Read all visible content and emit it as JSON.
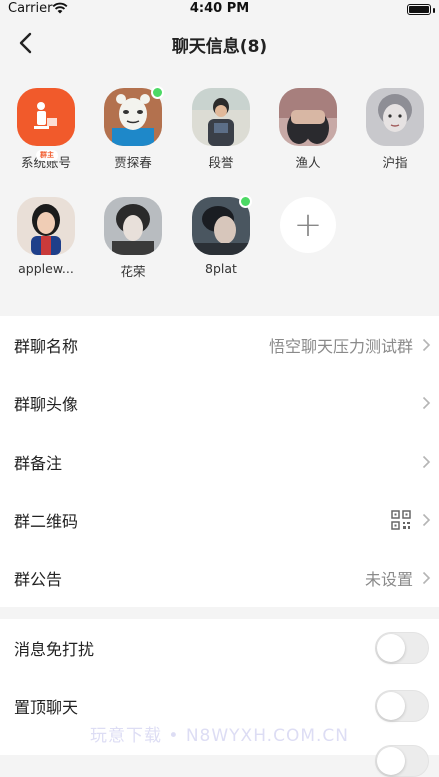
{
  "status": {
    "carrier": "Carrier",
    "time": "4:40 PM"
  },
  "nav": {
    "title": "聊天信息(8)"
  },
  "members": [
    {
      "name": "系统账号",
      "badge": "群主",
      "online": false
    },
    {
      "name": "贾探春",
      "online": true
    },
    {
      "name": "段誉",
      "online": false
    },
    {
      "name": "渔人",
      "online": false
    },
    {
      "name": "沪指",
      "online": false
    },
    {
      "name": "applew...",
      "online": false
    },
    {
      "name": "花荣",
      "online": false
    },
    {
      "name": "8plat",
      "online": true
    }
  ],
  "add_member": {
    "symbol": "+"
  },
  "group_settings": {
    "name_label": "群聊名称",
    "name_value": "悟空聊天压力测试群",
    "avatar_label": "群聊头像",
    "remark_label": "群备注",
    "qrcode_label": "群二维码",
    "notice_label": "群公告",
    "notice_value": "未设置"
  },
  "chat_settings": {
    "mute_label": "消息免打扰",
    "mute_on": false,
    "pin_label": "置顶聊天",
    "pin_on": false
  },
  "watermark": "玩意下载 • N8WYXH.COM.CN",
  "colors": {
    "brand": "#f15a2b",
    "online": "#4cd964",
    "background": "#f4f4f4"
  }
}
